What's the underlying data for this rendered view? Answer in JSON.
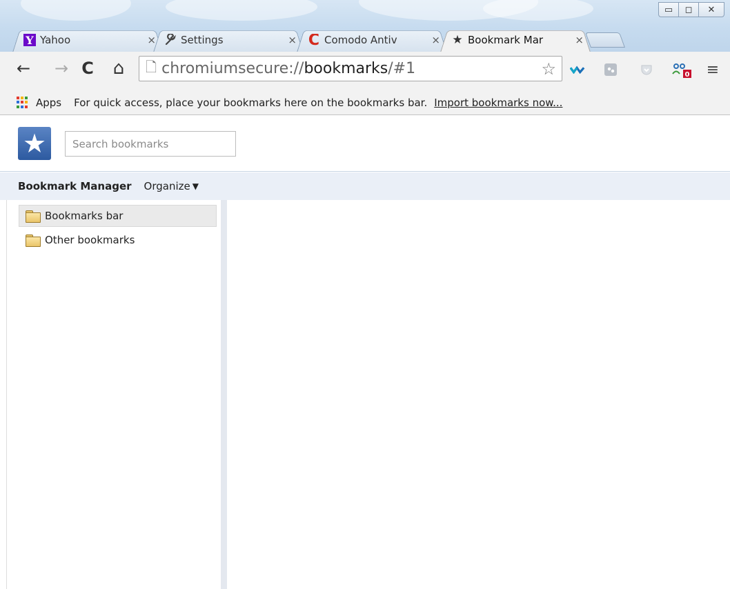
{
  "window": {
    "controls": {
      "minimize": "▭",
      "maximize": "◻",
      "close": "✕"
    }
  },
  "tabs": [
    {
      "title": "Yahoo",
      "favicon": "Y",
      "close": "×",
      "active": false
    },
    {
      "title": "Settings",
      "favicon": "wrench-icon",
      "close": "×",
      "active": false
    },
    {
      "title": "Comodo Antiv",
      "favicon": "C",
      "close": "×",
      "active": false
    },
    {
      "title": "Bookmark Mar",
      "favicon": "★",
      "close": "×",
      "active": true
    }
  ],
  "toolbar": {
    "back": "←",
    "forward": "→",
    "reload": "C",
    "home": "⌂",
    "url_scheme": "chromiumsecure://",
    "url_host": "bookmarks",
    "url_path": "/#1",
    "star": "☆",
    "extensions": [
      "wave-icon",
      "puzzle-icon",
      "pocket-icon",
      "notify-icon"
    ],
    "notify_badge": "0",
    "menu": "≡"
  },
  "bookmarks_bar": {
    "apps_label": "Apps",
    "hint": "For quick access, place your bookmarks here on the bookmarks bar.",
    "import_link": "Import bookmarks now..."
  },
  "bookmark_manager": {
    "search_placeholder": "Search bookmarks",
    "title": "Bookmark Manager",
    "organize_label": "Organize",
    "folders": [
      {
        "label": "Bookmarks bar",
        "selected": true
      },
      {
        "label": "Other bookmarks",
        "selected": false
      }
    ]
  },
  "colors": {
    "accent": "#2d5aa0",
    "menubar_bg": "#eaeff7",
    "comodo_red": "#d42a1d",
    "yahoo_purple": "#6b0ac9"
  }
}
